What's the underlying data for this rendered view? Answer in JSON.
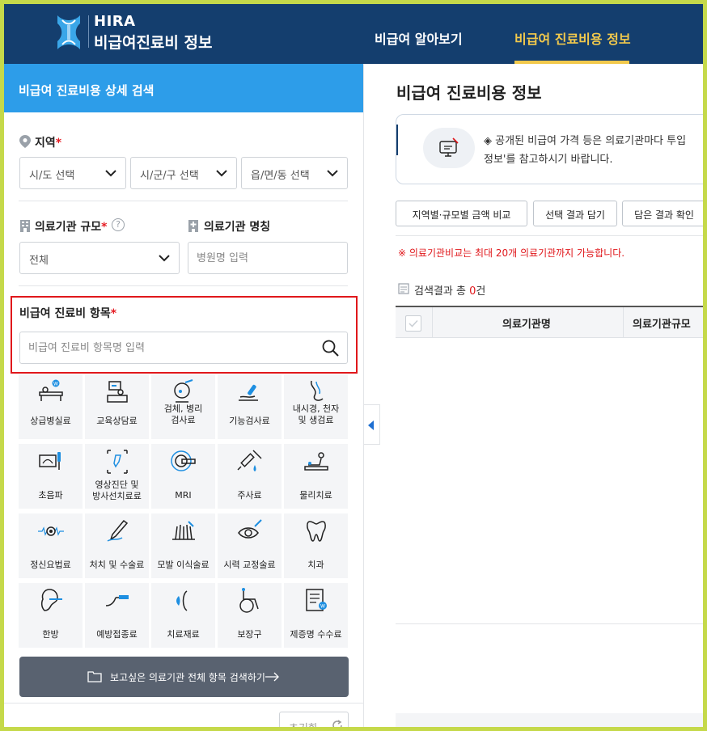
{
  "header": {
    "logo_top": "HIRA",
    "logo_bottom": "비급여진료비 정보",
    "nav": [
      "비급여 알아보기",
      "비급여 진료비용 정보"
    ]
  },
  "left": {
    "panel_title": "비급여 진료비용 상세 검색",
    "region": {
      "label": "지역",
      "required_mark": "*",
      "selects": [
        "시/도 선택",
        "시/군/구 선택",
        "읍/면/동 선택"
      ]
    },
    "scale": {
      "label": "의료기관 규모",
      "required_mark": "*",
      "value": "전체",
      "help_icon": "?"
    },
    "name": {
      "label": "의료기관 명칭",
      "placeholder": "병원명 입력"
    },
    "item": {
      "label": "비급여 진료비 항목",
      "required_mark": "*",
      "placeholder": "비급여 진료비 항목명 입력"
    },
    "categories": [
      {
        "label": "상급병실료",
        "icon": "hospital-bed-icon"
      },
      {
        "label": "교육상담료",
        "icon": "counseling-desk-icon"
      },
      {
        "label": "검체, 병리\n검사료",
        "icon": "microscope-test-icon"
      },
      {
        "label": "기능검사료",
        "icon": "function-test-icon"
      },
      {
        "label": "내시경, 천자\n및 생검료",
        "icon": "endoscope-icon"
      },
      {
        "label": "초음파",
        "icon": "ultrasound-icon"
      },
      {
        "label": "영상진단 및\n방사선치료료",
        "icon": "radiology-icon"
      },
      {
        "label": "MRI",
        "icon": "mri-icon"
      },
      {
        "label": "주사료",
        "icon": "syringe-icon"
      },
      {
        "label": "물리치료",
        "icon": "physiotherapy-icon"
      },
      {
        "label": "정신요법료",
        "icon": "brain-wave-icon"
      },
      {
        "label": "처치 및 수술료",
        "icon": "scalpel-icon"
      },
      {
        "label": "모발 이식술료",
        "icon": "hair-transplant-icon"
      },
      {
        "label": "시력 교정술료",
        "icon": "eye-laser-icon"
      },
      {
        "label": "치과",
        "icon": "tooth-icon"
      },
      {
        "label": "한방",
        "icon": "acupuncture-ear-icon"
      },
      {
        "label": "예방접종료",
        "icon": "vaccination-icon"
      },
      {
        "label": "치료재료",
        "icon": "treatment-material-icon"
      },
      {
        "label": "보장구",
        "icon": "wheelchair-icon"
      },
      {
        "label": "제증명 수수료",
        "icon": "certificate-icon"
      }
    ],
    "search_all_label": "보고싶은 의료기관 전체 항목 검색하기",
    "reset_label": "초기화"
  },
  "right": {
    "title": "비급여 진료비용 정보",
    "notice_line1": "◈ 공개된 비급여 가격 등은 의료기관마다 투입",
    "notice_line2": "정보'를 참고하시기 바랍니다.",
    "buttons": [
      "지역별·규모별 금액 비교",
      "선택 결과 담기",
      "담은 결과 확인"
    ],
    "note": "※ 의료기관비교는 최대 20개 의료기관까지 가능합니다.",
    "count_prefix": "검색결과 총 ",
    "count_value": "0",
    "count_suffix": "건",
    "columns": [
      "의료기관명",
      "의료기관규모"
    ]
  },
  "colors": {
    "header_bg": "#143e6e",
    "accent": "#f2c94c",
    "panel_bar": "#2d9de9",
    "required": "#e0171b",
    "frame": "#c5d94a"
  }
}
